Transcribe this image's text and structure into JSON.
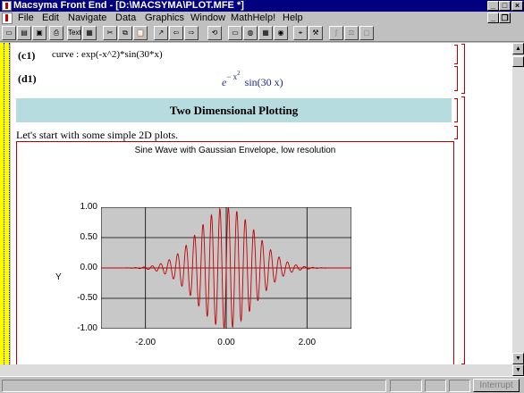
{
  "window": {
    "title": "Macsyma Front End - [D:\\MACSYMA\\PLOT.MFE *]"
  },
  "window_controls": {
    "minimize": "_",
    "maximize": "□",
    "close": "×"
  },
  "mdi_controls": {
    "minimize": "_",
    "restore": "❐"
  },
  "menu": [
    "File",
    "Edit",
    "Navigate",
    "Data",
    "Graphics",
    "Window",
    "MathHelp!",
    "Help"
  ],
  "toolbar": {
    "buttons": [
      {
        "icon": "new-icon",
        "glyph": "▭"
      },
      {
        "icon": "open-icon",
        "glyph": "▤"
      },
      {
        "icon": "save-icon",
        "glyph": "▣"
      },
      {
        "icon": "print-icon",
        "glyph": "⎙"
      },
      {
        "icon": "text-icon",
        "glyph": "Text"
      },
      {
        "icon": "table-icon",
        "glyph": "▦"
      },
      {
        "icon": "cut-icon",
        "glyph": "✂"
      },
      {
        "icon": "copy-icon",
        "glyph": "⧉"
      },
      {
        "icon": "paste-icon",
        "glyph": "📋"
      },
      {
        "icon": "pointer-icon",
        "glyph": "↗"
      },
      {
        "icon": "back-icon",
        "glyph": "⇦"
      },
      {
        "icon": "forward-icon",
        "glyph": "⇨"
      },
      {
        "icon": "evaluate-icon",
        "glyph": "⟲"
      },
      {
        "icon": "monitor-icon",
        "glyph": "▭"
      },
      {
        "icon": "globe-icon",
        "glyph": "◍"
      },
      {
        "icon": "calculator-icon",
        "glyph": "▦"
      },
      {
        "icon": "plot-icon",
        "glyph": "◉"
      },
      {
        "icon": "camera-icon",
        "glyph": "⌖"
      },
      {
        "icon": "tools-icon",
        "glyph": "⚒"
      },
      {
        "icon": "math-icon",
        "glyph": "∫"
      },
      {
        "icon": "scale-icon",
        "glyph": "⚖"
      },
      {
        "icon": "window-icon",
        "glyph": "▢"
      }
    ]
  },
  "document": {
    "c1_label": "(c1)",
    "c1_input": "curve : exp(-x^2)*sin(30*x)",
    "d1_label": "(d1)",
    "d1_base": "e",
    "d1_exponent": "− x",
    "d1_exponent_power": "2",
    "d1_rest": "sin(30 x)",
    "section_heading": "Two Dimensional Plotting",
    "intro_text": "Let's start with some simple 2D plots."
  },
  "chart_data": {
    "type": "line",
    "title": "Sine Wave with Gaussian Envelope, low resolution",
    "xlabel": "",
    "ylabel": "Y",
    "function": "exp(-x^2)*sin(30*x)",
    "xlim": [
      -3.1,
      3.1
    ],
    "ylim": [
      -1.0,
      1.0
    ],
    "x_ticks": [
      "-2.00",
      "0.00",
      "2.00"
    ],
    "y_ticks": [
      "1.00",
      "0.50",
      "0.00",
      "-0.50",
      "-1.00"
    ],
    "grid": true,
    "line_color": "#c00000",
    "background": "#c8c8c8"
  },
  "statusbar": {
    "interrupt_label": "Interrupt"
  }
}
